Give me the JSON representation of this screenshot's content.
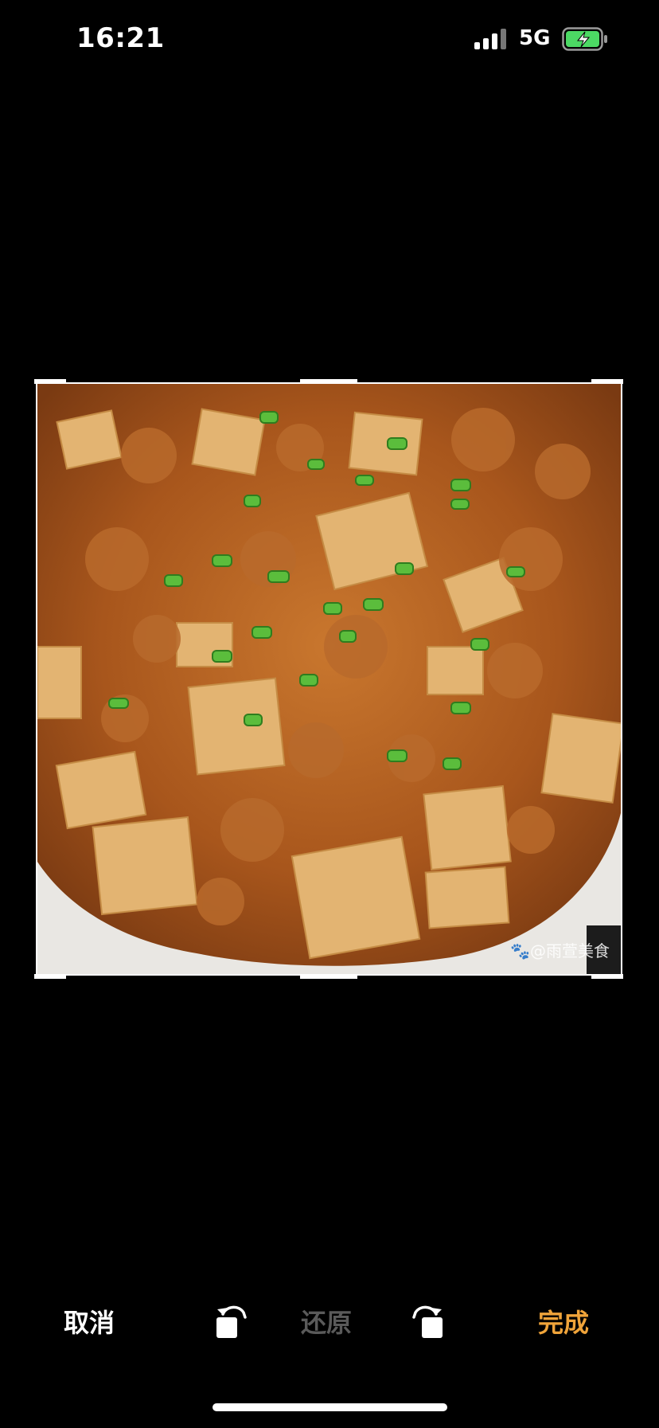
{
  "status_bar": {
    "time": "16:21",
    "network": "5G",
    "battery_icon": "battery-charging-icon",
    "signal_icon": "cellular-signal-icon"
  },
  "photo": {
    "watermark": "@雨萱美食",
    "watermark_icon": "paw-icon"
  },
  "toolbar": {
    "cancel_label": "取消",
    "reset_label": "还原",
    "done_label": "完成",
    "rotate_left_icon": "rotate-left-icon",
    "rotate_right_icon": "rotate-right-icon"
  },
  "colors": {
    "background": "#000000",
    "done_accent": "#f0a43a",
    "reset_disabled": "#5a5a5a",
    "battery_fill": "#4cd964"
  }
}
